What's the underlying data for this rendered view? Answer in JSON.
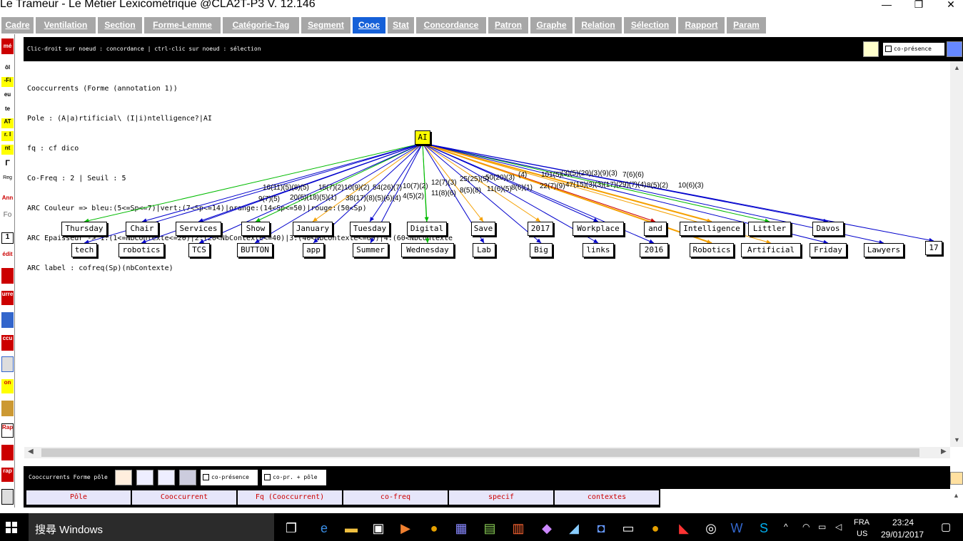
{
  "window": {
    "title": "Le Trameur - Le Métier Lexicométrique @CLA2T-P3 V. 12.146",
    "minimize": "—",
    "maximize": "❐",
    "close": "✕"
  },
  "tabs": [
    {
      "label": "Cadre",
      "active": false
    },
    {
      "label": "Ventilation",
      "active": false
    },
    {
      "label": "Section",
      "active": false
    },
    {
      "label": "Forme-Lemme",
      "active": false
    },
    {
      "label": "Catégorie-Tag",
      "active": false
    },
    {
      "label": "Segment",
      "active": false
    },
    {
      "label": "Cooc",
      "active": true
    },
    {
      "label": "Stat",
      "active": false
    },
    {
      "label": "Concordance",
      "active": false
    },
    {
      "label": "Patron",
      "active": false
    },
    {
      "label": "Graphe",
      "active": false
    },
    {
      "label": "Relation",
      "active": false
    },
    {
      "label": "Sélection",
      "active": false
    },
    {
      "label": "Rapport",
      "active": false
    },
    {
      "label": "Param",
      "active": false
    }
  ],
  "left_sidebar": [
    "mé",
    "ôl",
    "-Fi",
    "eu",
    "te",
    "AT",
    "r. I",
    "nt",
    "Γ",
    "Reg",
    "Ann",
    "Fo",
    "1",
    "édit",
    "",
    "urre",
    "",
    "ccu",
    "",
    "on",
    "",
    "Rap",
    "",
    "rap",
    ""
  ],
  "top_panel": {
    "hint": "Clic-droit sur noeud : concordance | ctrl-clic sur noeud : sélection",
    "copresence_label": "co-présence"
  },
  "info_lines": [
    "Cooccurrents (Forme (annotation 1))",
    "Pole : (A|a)rtificial\\ (I|i)ntelligence?|AI",
    "fq : cf dico",
    "Co-Freq : 2 | Seuil : 5",
    "ARC Couleur => bleu:(5<=Sp<=7)|vert:(7<Sp<=14)|orange:(14<Sp<=50)|rouge:(50<Sp)",
    "ARC Epaisseur -> 1:(1<=NbContexte<=20)|2:(20<NbContexte<=40)|3:(40<NbContexte<=60)|4:(60<NbContexte",
    "ARC label : cofreq(Sp)(nbContexte)"
  ],
  "colors": {
    "blue": "#0000cc",
    "green": "#00bb00",
    "orange": "#f5a000",
    "red": "#cc0000",
    "pole": "#ffff00",
    "tab_active": "#1560d8",
    "tab": "#a7a7a7"
  },
  "graph": {
    "pole": "AI",
    "nodes_row1": [
      "Thursday",
      "Chair",
      "Services",
      "Show",
      "January",
      "Tuesday",
      "Digital",
      "Save",
      "2017",
      "Workplace",
      "and",
      "Intelligence",
      "Littler",
      "Davos"
    ],
    "nodes_row2": [
      "tech",
      "robotics",
      "TCS",
      "BUTTON",
      "app",
      "Summer",
      "Wednesday",
      "Lab",
      "Big",
      "links",
      "2016",
      "Robotics",
      "Artificial",
      "Friday",
      "Lawyers",
      "17"
    ],
    "edge_labels": [
      "16(11)(5)(8)(5)",
      "9(7)(5)",
      "20(5)(18)(5)(1)",
      "15(7)(2)",
      "10(9)(2)",
      "38(17)(8)(5)(6)(4)",
      "54(26)(7)",
      "10(7)(2)",
      "4(5)(2)",
      "12(7)(3)",
      "11(8)(6)",
      "25(25)(5)",
      "8(5)(8)",
      "50(20)(3)",
      "11(6)(5)",
      "(4)",
      "8(6)(1)",
      "101(5)",
      "22(7)(9)",
      "(3)(5)(29)(3)(9)(3)",
      "47(15)(3)(3)(17)(29)(7)(4)",
      "7(6)(6)",
      "8(5)(2)",
      "10(6)(3)"
    ]
  },
  "bottom_panel": {
    "label": "Cooccurrents Forme pôle",
    "copresence_label": "co-présence",
    "copr_pole_label": "co-pr. + pôle"
  },
  "columns": [
    "Pôle",
    "Cooccurrent",
    "Fq (Cooccurrent)",
    "co-freq",
    "specif",
    "contextes"
  ],
  "taskbar": {
    "search_placeholder": "搜尋 Windows",
    "lang": "FRA",
    "region": "US",
    "time": "23:24",
    "date": "29/01/2017"
  }
}
